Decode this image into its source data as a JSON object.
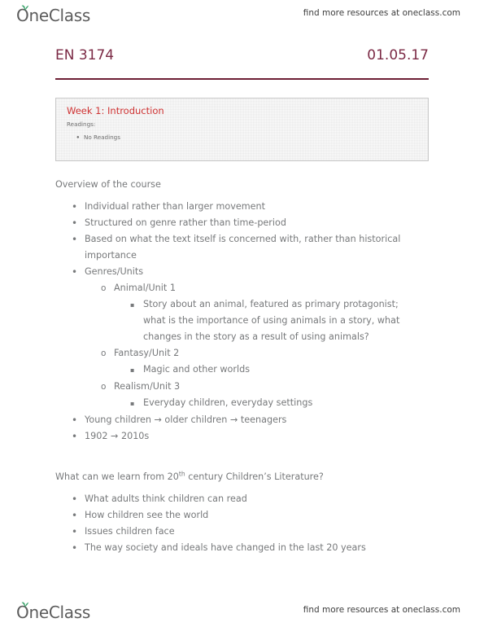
{
  "header": {
    "logo_text": "OneClass",
    "logo_icon": "leaf-sprout-icon",
    "resources_text": "find more resources at oneclass.com"
  },
  "footer": {
    "logo_text": "OneClass",
    "logo_icon": "leaf-sprout-icon",
    "resources_text": "find more resources at oneclass.com"
  },
  "title": {
    "course_code": "EN 3174",
    "date": "01.05.17"
  },
  "screenshot_box": {
    "heading": "Week 1: Introduction",
    "subheading": "Readings:",
    "bullet": "No Readings",
    "heading_color": "#cc2222"
  },
  "sections": [
    {
      "heading": "Overview of the course",
      "heading_suffix": "",
      "items": [
        {
          "level": 1,
          "text": "Individual rather than larger movement"
        },
        {
          "level": 1,
          "text": "Structured on genre rather than time-period"
        },
        {
          "level": 1,
          "text": "Based on what the text itself is concerned with, rather than historical importance"
        },
        {
          "level": 1,
          "text": "Genres/Units"
        },
        {
          "level": 2,
          "text": "Animal/Unit 1"
        },
        {
          "level": 3,
          "text": "Story about an animal, featured as primary protagonist; what is the importance of using animals in a story, what changes in the story as a result of using animals?"
        },
        {
          "level": 2,
          "text": "Fantasy/Unit 2"
        },
        {
          "level": 3,
          "text": "Magic and other worlds"
        },
        {
          "level": 2,
          "text": "Realism/Unit 3"
        },
        {
          "level": 3,
          "text": "Everyday children, everyday settings"
        },
        {
          "level": 1,
          "text": "Young children → older children → teenagers"
        },
        {
          "level": 1,
          "text": "1902 → 2010s"
        }
      ]
    },
    {
      "heading": "What can we learn from 20",
      "heading_sup": "th",
      "heading_suffix": " century Children’s Literature?",
      "items": [
        {
          "level": 1,
          "text": "What adults think children can read"
        },
        {
          "level": 1,
          "text": "How children see the world"
        },
        {
          "level": 1,
          "text": "Issues children face"
        },
        {
          "level": 1,
          "text": "The way society and ideals have changed in the last 20 years"
        }
      ]
    }
  ],
  "markers": {
    "level1": "•",
    "level2": "o",
    "level3": "▪"
  },
  "colors": {
    "accent_maroon": "#7b2a45",
    "rule": "#6d1f35",
    "body_text": "#77797b",
    "logo_leaf_green": "#2f9e63"
  }
}
